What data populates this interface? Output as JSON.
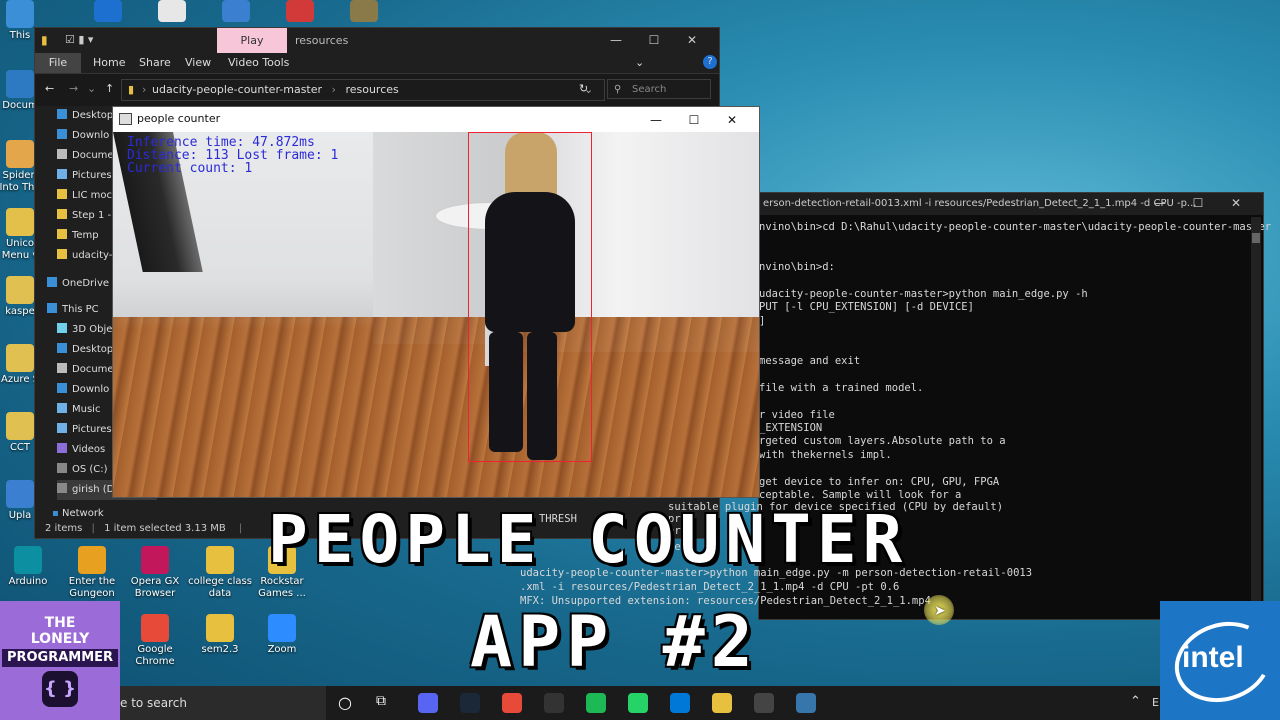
{
  "desktop": {
    "left_icons": [
      {
        "label": "This",
        "color": "#3a8fd6"
      },
      {
        "label": "Docum",
        "color": "#2e7ac2"
      },
      {
        "label": "Spider-\nInto The",
        "color": "#e3a64a"
      },
      {
        "label": "Unico\nMenu v",
        "color": "#e3c04a"
      },
      {
        "label": "kaspe",
        "color": "#e0c050"
      },
      {
        "label": "Azure S",
        "color": "#e0c050"
      },
      {
        "label": "CCT",
        "color": "#e0c050"
      },
      {
        "label": "Upla",
        "color": "#3a7fd0"
      }
    ],
    "top_icons": [
      {
        "color": "#1d6fd0"
      },
      {
        "color": "#e7e7e7"
      },
      {
        "color": "#3a7fd0"
      },
      {
        "color": "#d23a3a"
      },
      {
        "color": "#8a7a4a"
      }
    ],
    "bottom_icons": [
      {
        "label": "Arduino",
        "color": "#0c8fa0"
      },
      {
        "label": "Enter the\nGungeon",
        "color": "#e8a020"
      },
      {
        "label": "Opera GX\nBrowser",
        "color": "#c2185b"
      },
      {
        "label": "college class\ndata",
        "color": "#e8c040"
      },
      {
        "label": "Rockstar\nGames ...",
        "color": "#e8c040"
      },
      {
        "label": "Google\nChrome",
        "color": "#e84a3a"
      },
      {
        "label": "sem2.3",
        "color": "#e8c040"
      },
      {
        "label": "Zoom",
        "color": "#2d8cff"
      }
    ]
  },
  "explorer": {
    "play_tab": "Play",
    "title": "resources",
    "ribbon": [
      "File",
      "Home",
      "Share",
      "View",
      "Video Tools"
    ],
    "breadcrumb": [
      "udacity-people-counter-master",
      "resources"
    ],
    "search_placeholder": "Search resourc...",
    "nav": [
      "Desktop",
      "Downlo",
      "Docume",
      "Pictures",
      "LIC moc",
      "Step 1 -",
      "Temp",
      "udacity-",
      "OneDrive",
      "This PC",
      "3D Objec",
      "Desktop",
      "Docume",
      "Downlo",
      "Music",
      "Pictures",
      "Videos",
      "OS (C:)",
      "girish (D"
    ],
    "network": "Network",
    "status": [
      "2 items",
      "1 item selected 3.13 MB"
    ]
  },
  "people_counter": {
    "title": "people counter",
    "overlay": [
      "Inference time: 47.872ms",
      "Distance: 113 Lost frame: 1",
      "Current count: 1"
    ]
  },
  "terminal": {
    "title": "erson-detection-retail-0013.xml -i resources/Pedestrian_Detect_2_1_1.mp4 -d CPU -p...",
    "lines": [
      "nvino\\bin>cd D:\\Rahul\\udacity-people-counter-master\\udacity-people-counter-master",
      "",
      "",
      "nvino\\bin>d:",
      "",
      "udacity-people-counter-master>python main_edge.py -h",
      "PUT [-l CPU_EXTENSION] [-d DEVICE]",
      "]",
      "",
      "",
      "message and exit",
      "",
      "file with a trained model.",
      "",
      "r video file",
      "_EXTENSION",
      "rgeted custom layers.Absolute path to a",
      "with thekernels impl.",
      "",
      "get device to infer on: CPU, GPU, FPGA",
      "ceptable. Sample will look for a"
    ],
    "lower_lines": [
      "suitable plugin for device specified (CPU by default)",
      "-p THRESH",
      "pro",
      "prob",
      "defa",
      "udacity-people-counter-master>python main_edge.py -m person-detection-retail-0013",
      ".xml -i resources/Pedestrian_Detect_2_1_1.mp4 -d CPU -pt 0.6",
      "MFX: Unsupported extension: resources/Pedestrian_Detect_2_1_1.mp4"
    ]
  },
  "headline": {
    "line1": "PEOPLE COUNTER",
    "line2": "APP #2"
  },
  "badge": {
    "line1": "THE",
    "line2": "LONELY",
    "line3": "PROGRAMMER"
  },
  "intel": {
    "text": "intel"
  },
  "taskbar": {
    "search": "e to search",
    "apps": [
      "#5865f2",
      "#1b2838",
      "#e84a3a",
      "#333",
      "#1db954",
      "#25d366",
      "#0078d7",
      "#e8c040",
      "#444",
      "#3776ab"
    ],
    "tray": "EN"
  }
}
